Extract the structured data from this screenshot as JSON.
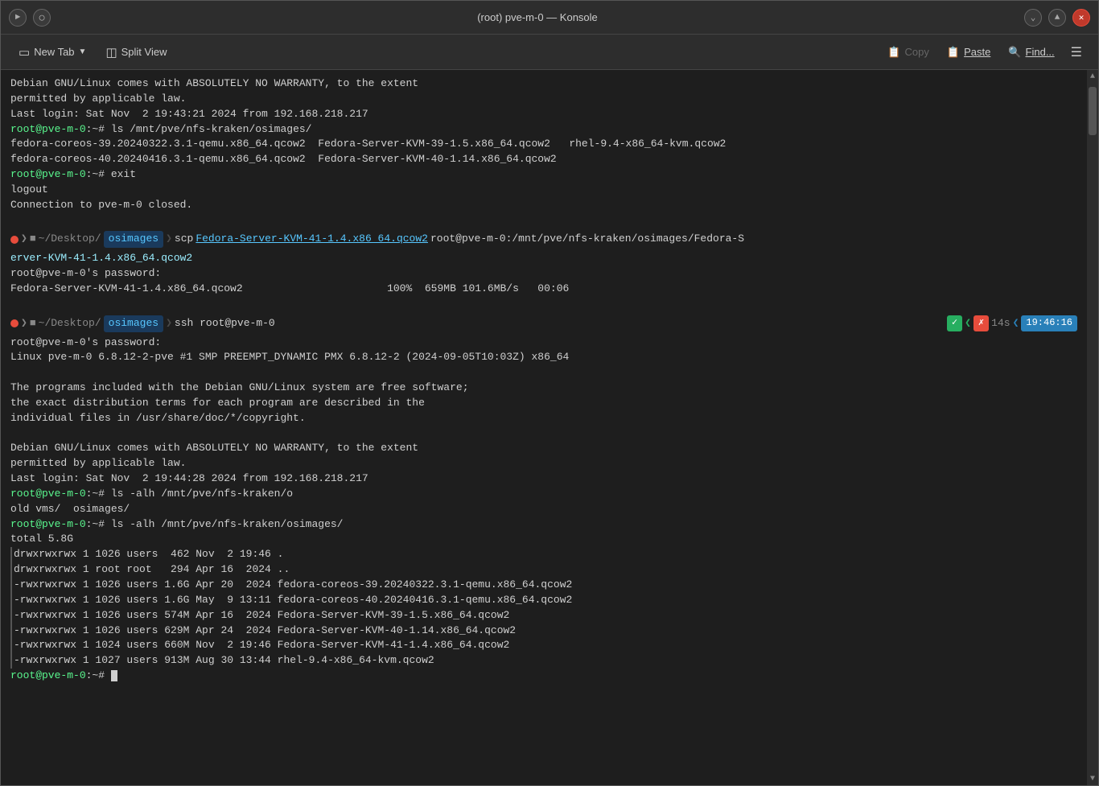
{
  "window": {
    "title": "(root) pve-m-0 — Konsole"
  },
  "toolbar": {
    "new_tab": "New Tab",
    "split_view": "Split View",
    "copy": "Copy",
    "paste": "Paste",
    "find": "Find..."
  },
  "terminal": {
    "lines": [
      "Debian GNU/Linux comes with ABSOLUTELY NO WARRANTY, to the extent",
      "permitted by applicable law.",
      "Last login: Sat Nov  2 19:43:21 2024 from 192.168.218.217",
      "root@pve-m-0:~# ls /mnt/pve/nfs-kraken/osimages/",
      "fedora-coreos-39.20240322.3.1-qemu.x86_64.qcow2  Fedora-Server-KVM-39-1.5.x86_64.qcow2   rhel-9.4-x86_64-kvm.qcow2",
      "fedora-coreos-40.20240416.3.1-qemu.x86_64.qcow2  Fedora-Server-KVM-40-1.14.x86_64.qcow2",
      "root@pve-m-0:~# exit",
      "logout",
      "Connection to pve-m-0 closed.",
      "",
      "scp Fedora-Server-KVM-41-1.4.x86_64.qcow2 root@pve-m-0:/mnt/pve/nfs-kraken/osimages/Fedora-Server-KVM-41-1.4.x86_64.qcow2",
      "root@pve-m-0's password:",
      "Fedora-Server-KVM-41-1.4.x86_64.qcow2                       100%  659MB 101.6MB/s   00:06",
      "",
      "ssh root@pve-m-0",
      "root@pve-m-0's password:",
      "Linux pve-m-0 6.8.12-2-pve #1 SMP PREEMPT_DYNAMIC PMX 6.8.12-2 (2024-09-05T10:03Z) x86_64",
      "",
      "The programs included with the Debian GNU/Linux system are free software;",
      "the exact distribution terms for each program are described in the",
      "individual files in /usr/share/doc/*/copyright.",
      "",
      "Debian GNU/Linux comes with ABSOLUTELY NO WARRANTY, to the extent",
      "permitted by applicable law.",
      "Last login: Sat Nov  2 19:44:28 2024 from 192.168.218.217",
      "root@pve-m-0:~# ls -alh /mnt/pve/nfs-kraken/o",
      "old vms/  osimages/",
      "root@pve-m-0:~# ls -alh /mnt/pve/nfs-kraken/osimages/",
      "total 5.8G",
      "drwxrwxrwx 1 1026 users  462 Nov  2 19:46 .",
      "drwxrwxrwx 1 root root   294 Apr 16  2024 ..",
      "-rwxrwxrwx 1 1026 users 1.6G Apr 20  2024 fedora-coreos-39.20240322.3.1-qemu.x86_64.qcow2",
      "-rwxrwxrwx 1 1026 users 1.6G May  9 13:11 fedora-coreos-40.20240416.3.1-qemu.x86_64.qcow2",
      "-rwxrwxrwx 1 1026 users 574M Apr 16  2024 Fedora-Server-KVM-39-1.5.x86_64.qcow2",
      "-rwxrwxrwx 1 1026 users 629M Apr 24  2024 Fedora-Server-KVM-40-1.14.x86_64.qcow2",
      "-rwxrwxrwx 1 1024 users 660M Nov  2 19:46 Fedora-Server-KVM-41-1.4.x86_64.qcow2",
      "-rwxrwxrwx 1 1027 users 913M Aug 30 13:44 rhel-9.4-x86_64-kvm.qcow2",
      "root@pve-m-0:~# "
    ],
    "status": {
      "ok": "✓",
      "arrow_l1": "❮",
      "x_symbol": "✗",
      "time_label": "14s",
      "time_arrow": "❮",
      "clock": "19:46:16"
    }
  }
}
